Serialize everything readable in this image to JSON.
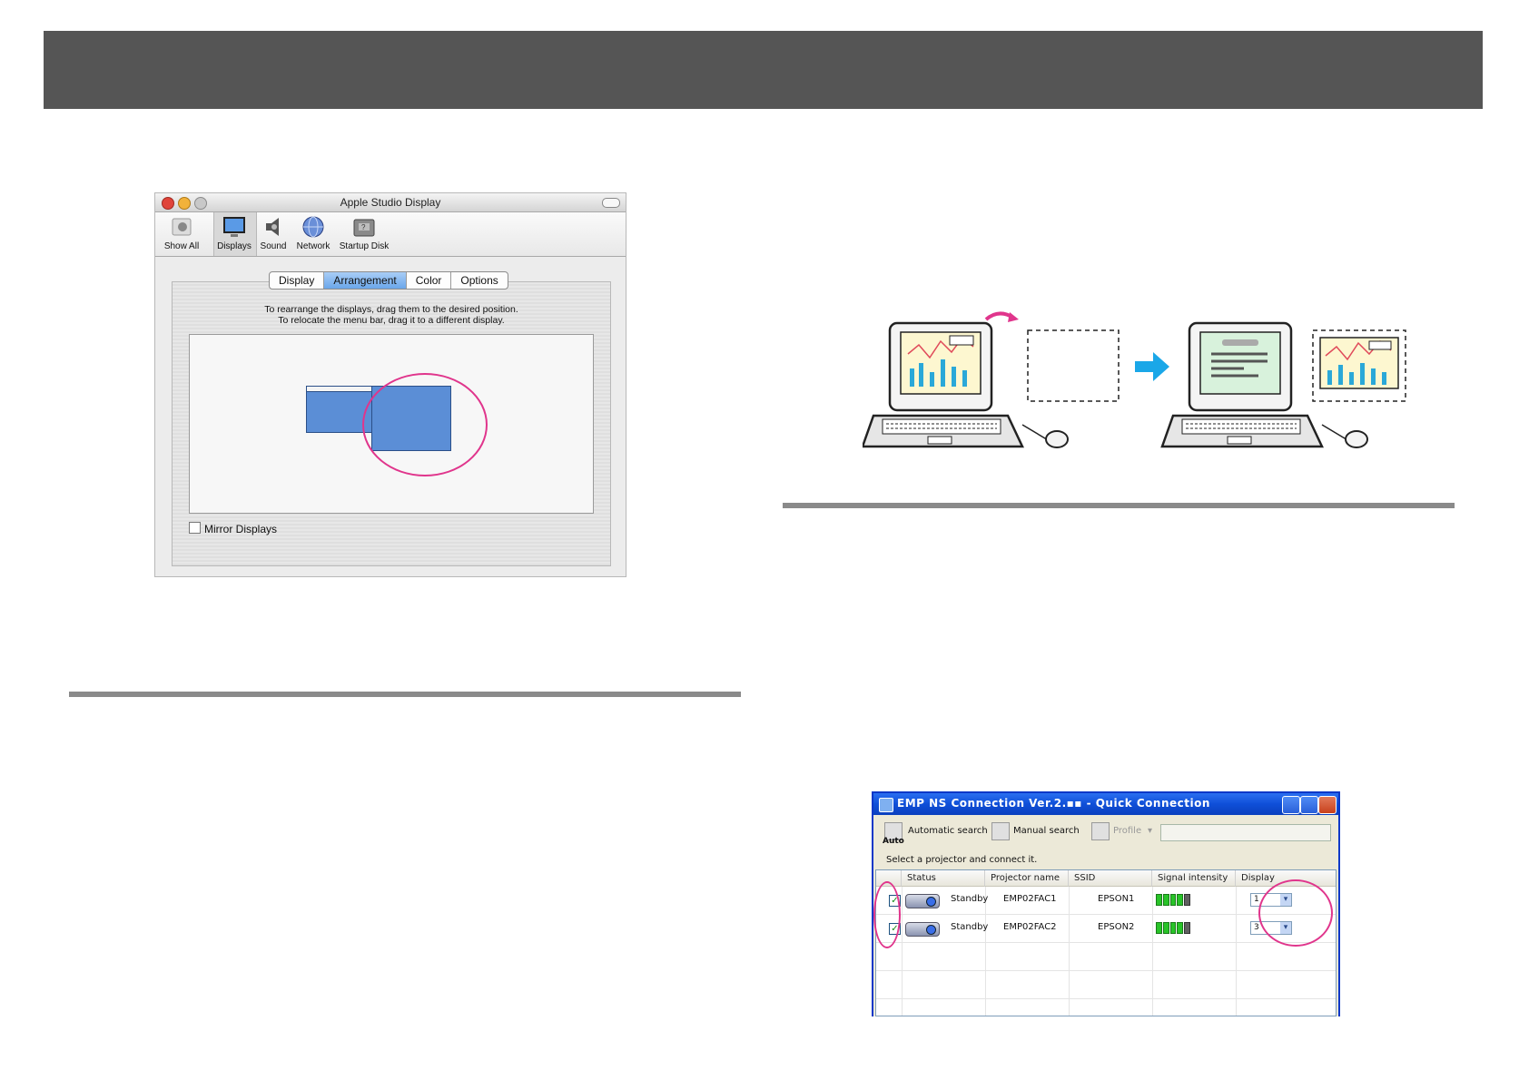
{
  "mac_window": {
    "title": "Apple Studio Display",
    "toolbar": [
      {
        "label": "Show All",
        "icon": "apple-icon"
      },
      {
        "label": "Displays",
        "icon": "display-icon"
      },
      {
        "label": "Sound",
        "icon": "speaker-icon"
      },
      {
        "label": "Network",
        "icon": "globe-icon"
      },
      {
        "label": "Startup Disk",
        "icon": "disk-icon"
      }
    ],
    "tabs": [
      "Display",
      "Arrangement",
      "Color",
      "Options"
    ],
    "selected_tab": "Arrangement",
    "instruction_line1": "To rearrange the displays, drag them to the desired position.",
    "instruction_line2": "To relocate the menu bar, drag it to a different display.",
    "mirror_label": "Mirror Displays",
    "mirror_checked": false,
    "highlight_color": "#e0358c",
    "display_color": "#5b8ed6"
  },
  "illustration": {
    "left_icon": "laptop-with-extended-empty-display-icon",
    "arrow_icon": "right-arrow-icon",
    "right_icon": "laptop-with-chart-moved-to-second-display-icon",
    "arrow_color": "#1aa7e8",
    "curve_arrow_color": "#e0358c"
  },
  "xp_window": {
    "title": "EMP NS Connection Ver.2.▪▪ - Quick Connection",
    "toolbar": {
      "auto_label": "Auto",
      "automatic_search": "Automatic search",
      "manual_search": "Manual search",
      "profile": "Profile"
    },
    "hint": "Select a projector and connect it.",
    "columns": [
      "Status",
      "Projector name",
      "SSID",
      "Signal intensity",
      "Display"
    ],
    "rows": [
      {
        "checked": true,
        "status": "Standby",
        "projector_name": "EMP02FAC1",
        "ssid": "EPSON1",
        "signal_bars": 4,
        "display": "1"
      },
      {
        "checked": true,
        "status": "Standby",
        "projector_name": "EMP02FAC2",
        "ssid": "EPSON2",
        "signal_bars": 4,
        "display": "3"
      }
    ]
  }
}
